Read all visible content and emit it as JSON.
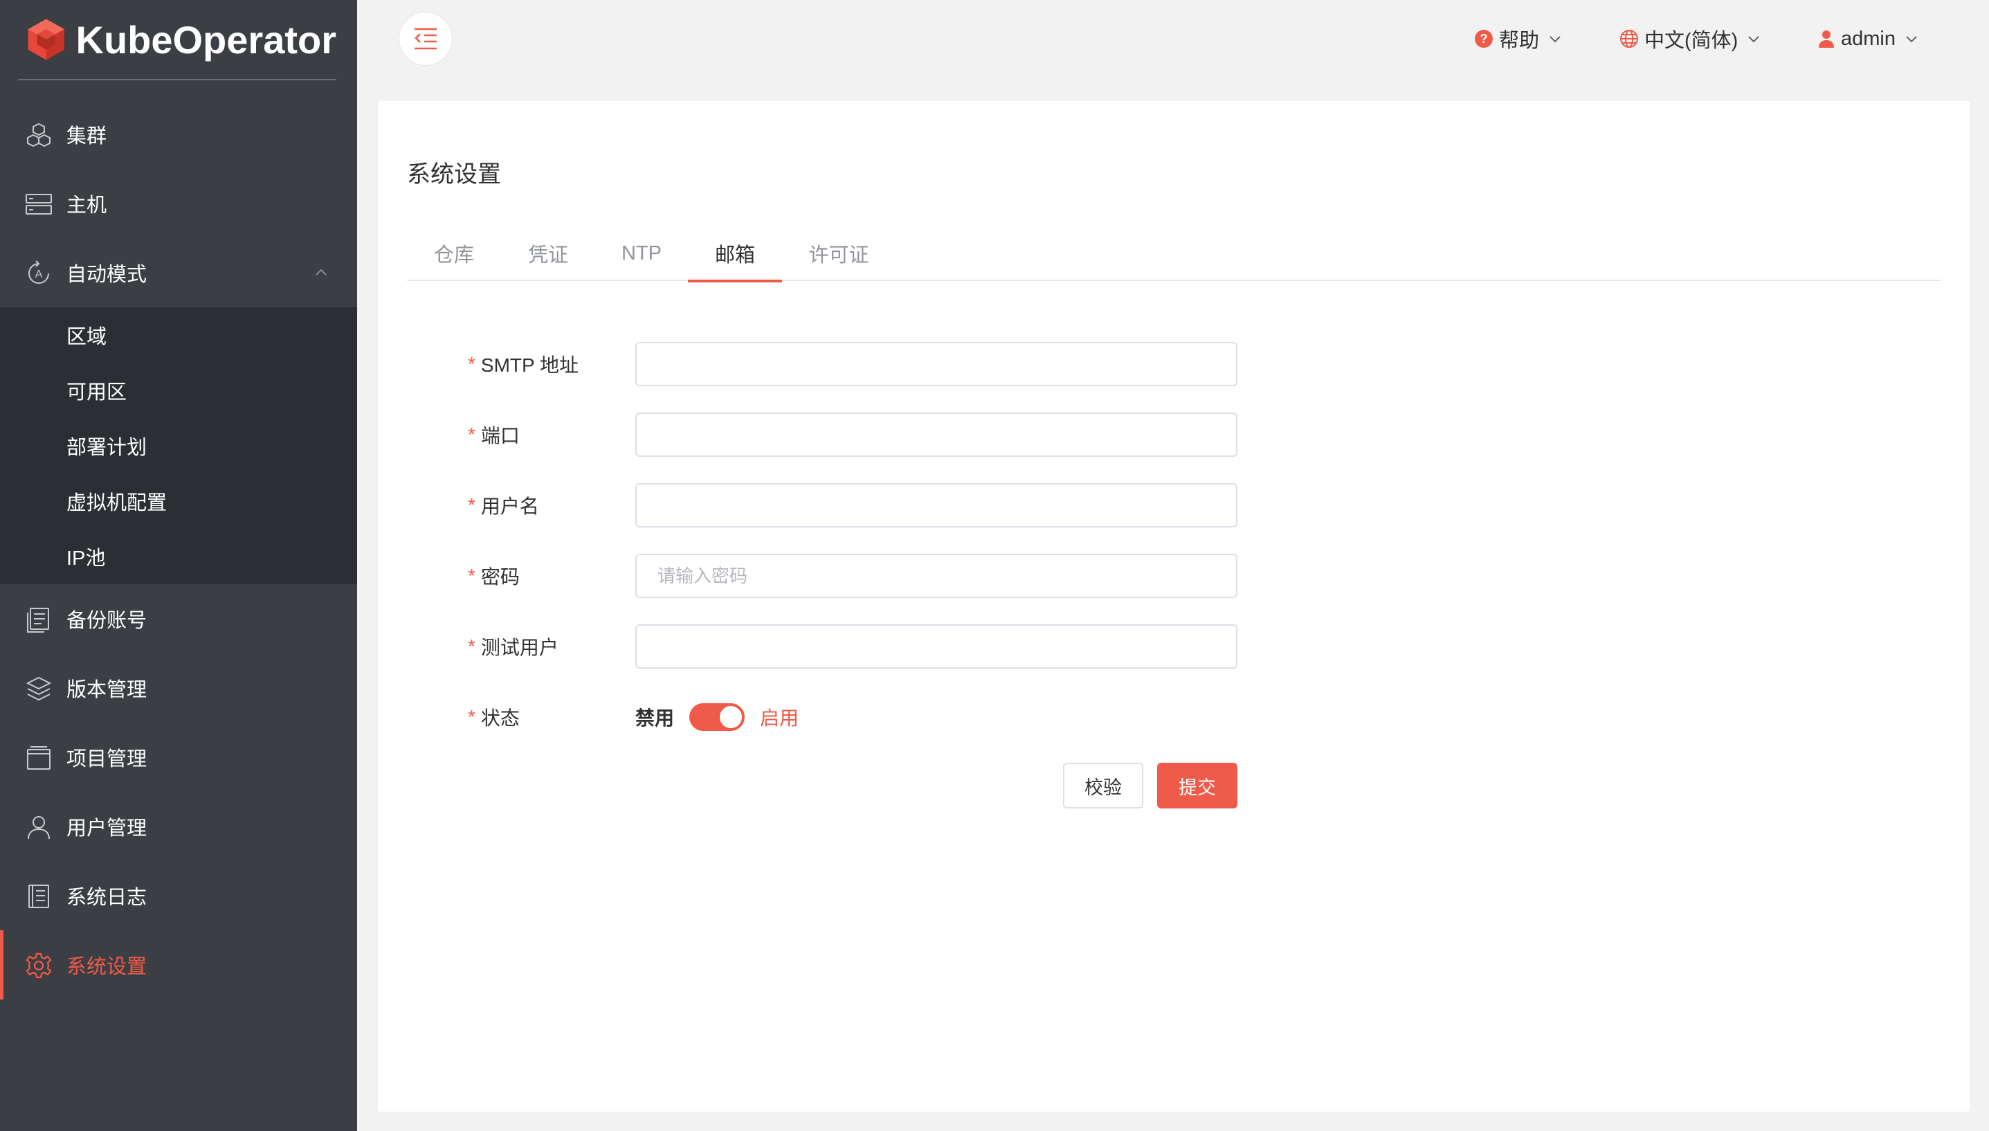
{
  "app": {
    "logo_text": "KubeOperator"
  },
  "sidebar": {
    "items": [
      {
        "label": "集群",
        "icon": "cubes-icon"
      },
      {
        "label": "主机",
        "icon": "server-icon"
      },
      {
        "label": "自动模式",
        "icon": "auto-mode-icon",
        "expanded": true
      },
      {
        "label": "备份账号",
        "icon": "backup-icon"
      },
      {
        "label": "版本管理",
        "icon": "layers-icon"
      },
      {
        "label": "项目管理",
        "icon": "project-icon"
      },
      {
        "label": "用户管理",
        "icon": "user-icon"
      },
      {
        "label": "系统日志",
        "icon": "log-icon"
      },
      {
        "label": "系统设置",
        "icon": "gear-icon",
        "active": true
      }
    ],
    "submenu": [
      "区域",
      "可用区",
      "部署计划",
      "虚拟机配置",
      "IP池"
    ]
  },
  "header": {
    "help": "帮助",
    "language": "中文(简体)",
    "user": "admin"
  },
  "page": {
    "title": "系统设置",
    "tabs": [
      "仓库",
      "凭证",
      "NTP",
      "邮箱",
      "许可证"
    ],
    "active_tab": "邮箱"
  },
  "form": {
    "fields": [
      {
        "label": "SMTP 地址",
        "value": "",
        "placeholder": ""
      },
      {
        "label": "端口",
        "value": "",
        "placeholder": ""
      },
      {
        "label": "用户名",
        "value": "",
        "placeholder": ""
      },
      {
        "label": "密码",
        "value": "",
        "placeholder": "请输入密码"
      },
      {
        "label": "测试用户",
        "value": "",
        "placeholder": ""
      }
    ],
    "status": {
      "label": "状态",
      "off_label": "禁用",
      "on_label": "启用",
      "enabled": true
    },
    "required_mark": "*",
    "verify_button": "校验",
    "submit_button": "提交"
  },
  "colors": {
    "accent": "#f05a48",
    "sidebar_bg": "#3b3e42",
    "submenu_bg": "#2b2e32",
    "page_bg": "#f2f2f2"
  }
}
